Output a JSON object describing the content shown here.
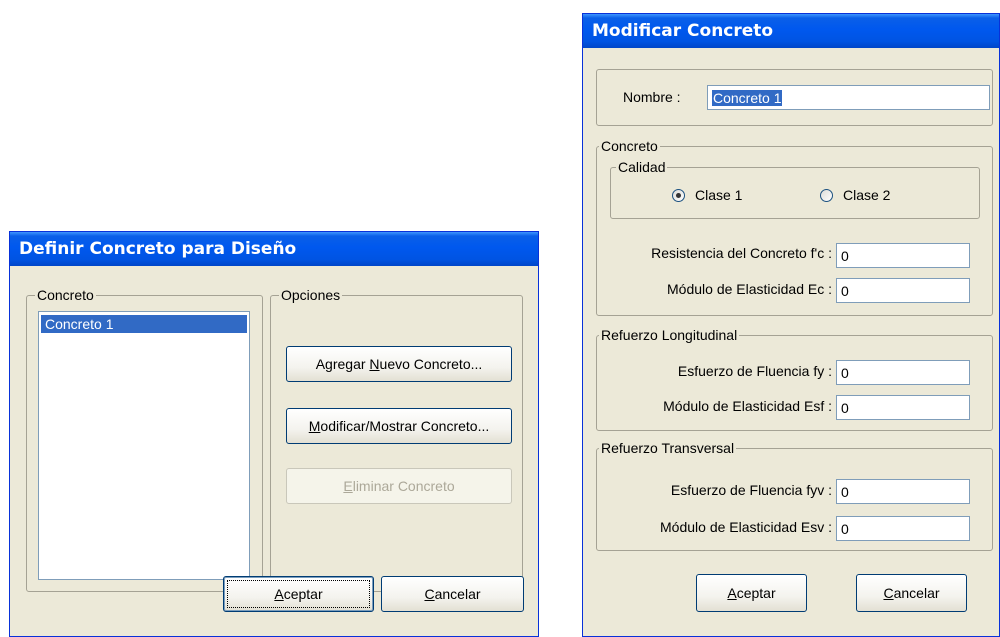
{
  "left_dialog": {
    "title": "Definir Concreto para Diseño",
    "concreto_group": {
      "label": "Concreto",
      "items": [
        "Concreto 1"
      ]
    },
    "opciones_group": {
      "label": "Opciones",
      "add_button": {
        "pre": "Agregar ",
        "mnemonic": "N",
        "post": "uevo Concreto..."
      },
      "modify_button": {
        "pre": "",
        "mnemonic": "M",
        "post": "odificar/Mostrar Concreto..."
      },
      "delete_button": {
        "pre": "",
        "mnemonic": "E",
        "post": "liminar Concreto"
      }
    },
    "ok_button": {
      "mnemonic": "A",
      "post": "ceptar"
    },
    "cancel_button": {
      "mnemonic": "C",
      "post": "ancelar"
    }
  },
  "right_dialog": {
    "title": "Modificar Concreto",
    "nombre_label": "Nombre :",
    "nombre_value": "Concreto 1",
    "concreto_group": {
      "label": "Concreto",
      "calidad_group": {
        "label": "Calidad",
        "clase1_label": "Clase 1",
        "clase2_label": "Clase 2",
        "selected": "Clase 1"
      },
      "resistencia_label": "Resistencia del Concreto f'c :",
      "resistencia_value": "0",
      "modulo_ec_label": "Módulo de Elasticidad Ec :",
      "modulo_ec_value": "0"
    },
    "long_group": {
      "label": "Refuerzo Longitudinal",
      "fy_label": "Esfuerzo de Fluencia fy :",
      "fy_value": "0",
      "esf_label": "Módulo de Elasticidad Esf :",
      "esf_value": "0"
    },
    "trans_group": {
      "label": "Refuerzo Transversal",
      "fyv_label": "Esfuerzo de Fluencia fyv :",
      "fyv_value": "0",
      "esv_label": "Módulo de Elasticidad Esv :",
      "esv_value": "0"
    },
    "ok_button": {
      "mnemonic": "A",
      "post": "ceptar"
    },
    "cancel_button": {
      "mnemonic": "C",
      "post": "ancelar"
    }
  }
}
